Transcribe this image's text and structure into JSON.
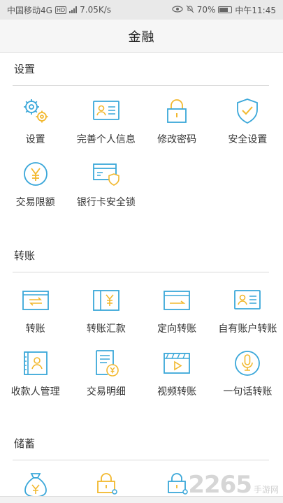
{
  "status_bar": {
    "carrier": "中国移动4G",
    "speed": "7.05K/s",
    "battery": "70%",
    "time": "中午11:45"
  },
  "nav": {
    "title": "金融"
  },
  "colors": {
    "icon_blue": "#3aa7d9",
    "icon_yellow": "#f2b82e",
    "divider": "#d9d9d9"
  },
  "sections": {
    "settings": {
      "title": "设置",
      "items": [
        {
          "label": "设置",
          "icon": "gears-icon"
        },
        {
          "label": "完善个人信息",
          "icon": "id-card-icon"
        },
        {
          "label": "修改密码",
          "icon": "lock-icon"
        },
        {
          "label": "安全设置",
          "icon": "shield-check-icon"
        },
        {
          "label": "交易限额",
          "icon": "yuan-coin-icon"
        },
        {
          "label": "银行卡安全锁",
          "icon": "card-shield-icon"
        }
      ]
    },
    "transfer": {
      "title": "转账",
      "items": [
        {
          "label": "转账",
          "icon": "transfer-card-icon"
        },
        {
          "label": "转账汇款",
          "icon": "yuan-card-icon"
        },
        {
          "label": "定向转账",
          "icon": "directed-transfer-icon"
        },
        {
          "label": "自有账户转账",
          "icon": "own-account-card-icon"
        },
        {
          "label": "收款人管理",
          "icon": "payee-book-icon"
        },
        {
          "label": "交易明细",
          "icon": "statement-icon"
        },
        {
          "label": "视频转账",
          "icon": "video-icon"
        },
        {
          "label": "一句话转账",
          "icon": "microphone-icon"
        }
      ]
    },
    "savings": {
      "title": "储蓄",
      "items": [
        {
          "icon": "money-bag-icon"
        },
        {
          "icon": "lock-user-icon"
        },
        {
          "icon": "lock-user-icon"
        }
      ]
    }
  },
  "watermark": {
    "number": "2265",
    "text": "手游网"
  }
}
